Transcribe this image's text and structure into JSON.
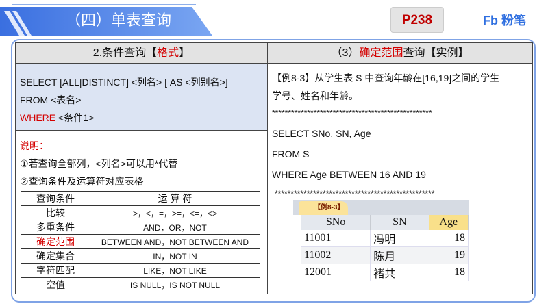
{
  "header": {
    "title": "（四）单表查询",
    "page": "P238",
    "logo": "粉笔"
  },
  "left": {
    "heading_prefix": "2.条件查询【",
    "heading_red": "格式",
    "heading_suffix": "】",
    "syntax": [
      "SELECT [ALL|DISTINCT] <列名> [ AS <列别名>]",
      "FROM <表名>"
    ],
    "where_kw": "WHERE",
    "where_rest": " <条件1>",
    "note_label": "说明：",
    "notes": [
      "①若查询全部列，<列名>可以用*代替",
      "②查询条件及运算符对应表格"
    ],
    "table": {
      "headers": [
        "查询条件",
        "运 算 符"
      ],
      "rows": [
        [
          "比较",
          ">，<，=，>=，<=，<>"
        ],
        [
          "多重条件",
          "AND，OR，NOT"
        ],
        [
          "确定范围",
          "BETWEEN AND，NOT BETWEEN AND"
        ],
        [
          "确定集合",
          "IN，NOT IN"
        ],
        [
          "字符匹配",
          "LIKE，NOT LIKE"
        ],
        [
          "空值",
          "IS NULL，IS NOT NULL"
        ]
      ]
    }
  },
  "right": {
    "heading_prefix": "（3）",
    "heading_red": "确定范围",
    "heading_suffix": "查询【实例】",
    "example": [
      "【例8-3】从学生表 S 中查询年龄在[16,19]之间的学生",
      "学号、姓名和年龄。"
    ],
    "stars": "**************************************************",
    "sql": [
      "SELECT SNo, SN, Age",
      "FROM S",
      "WHERE Age BETWEEN 16 AND 19"
    ],
    "result": {
      "tab": "【例8-3】",
      "headers": [
        "SNo",
        "SN",
        "Age"
      ],
      "rows": [
        [
          "11001",
          "冯明",
          "18"
        ],
        [
          "11002",
          "陈月",
          "19"
        ],
        [
          "12001",
          "褚共",
          "18"
        ]
      ]
    }
  }
}
